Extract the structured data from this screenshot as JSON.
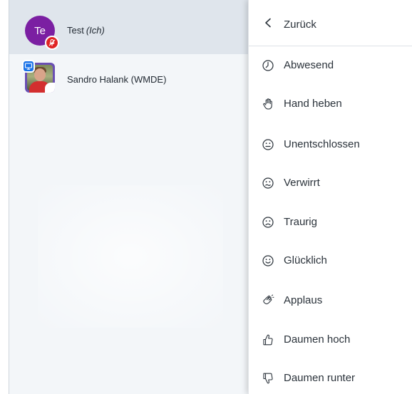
{
  "users": [
    {
      "initials": "Te",
      "name": "Test",
      "me_label": "(Ich)",
      "avatar_color": "#7b1fa2",
      "badge_icon": "muted-microphone-icon",
      "badge_color": "#e02424"
    },
    {
      "name": "Sandro Halank (WMDE)",
      "avatar_type": "photo",
      "badge_icon": "presenter-screen-icon",
      "badge_color": "#1a73e8"
    }
  ],
  "menu": {
    "back_label": "Zurück",
    "back_icon": "chevron-left-icon",
    "items": [
      {
        "label": "Abwesend",
        "icon": "clock-icon"
      },
      {
        "label": "Hand heben",
        "icon": "raised-hand-icon"
      },
      {
        "label": "Unentschlossen",
        "icon": "neutral-face-icon"
      },
      {
        "label": "Verwirrt",
        "icon": "confused-face-icon"
      },
      {
        "label": "Traurig",
        "icon": "sad-face-icon"
      },
      {
        "label": "Glücklich",
        "icon": "happy-face-icon"
      },
      {
        "label": "Applaus",
        "icon": "clapping-hands-icon"
      },
      {
        "label": "Daumen hoch",
        "icon": "thumbs-up-icon"
      },
      {
        "label": "Daumen runter",
        "icon": "thumbs-down-icon"
      }
    ]
  }
}
